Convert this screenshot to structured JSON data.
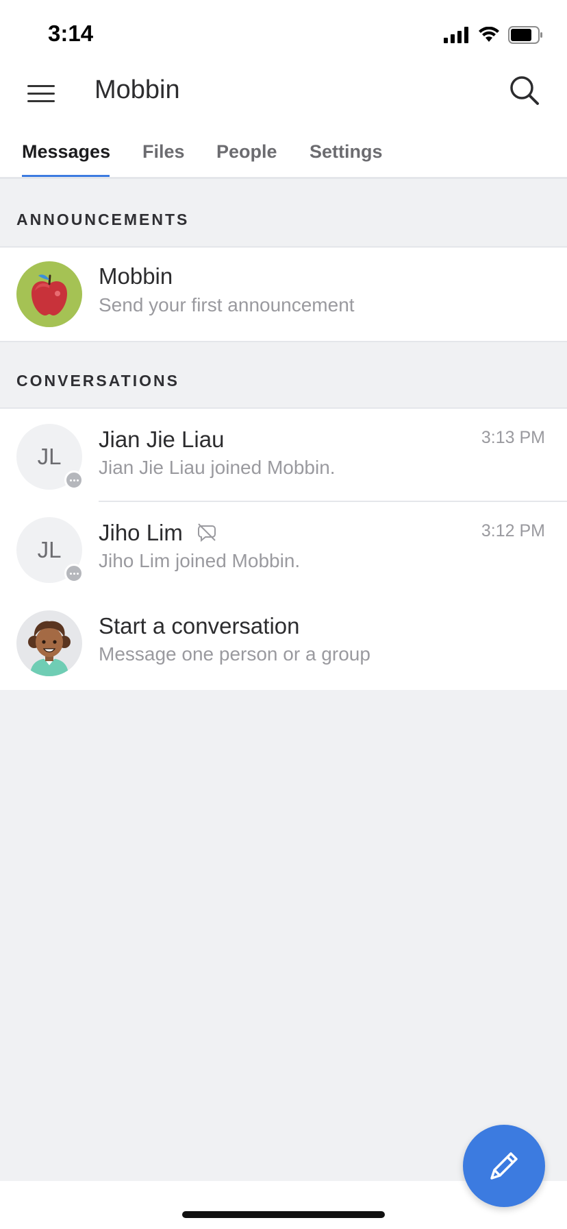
{
  "status_bar": {
    "time": "3:14"
  },
  "header": {
    "title": "Mobbin",
    "menu_icon": "hamburger-menu-icon",
    "search_icon": "search-icon"
  },
  "tabs": [
    {
      "label": "Messages",
      "active": true
    },
    {
      "label": "Files",
      "active": false
    },
    {
      "label": "People",
      "active": false
    },
    {
      "label": "Settings",
      "active": false
    }
  ],
  "announcements": {
    "heading": "ANNOUNCEMENTS",
    "item": {
      "title": "Mobbin",
      "subtitle": "Send your first announcement",
      "avatar_icon": "apple-icon"
    }
  },
  "conversations": {
    "heading": "CONVERSATIONS",
    "items": [
      {
        "initials": "JL",
        "name": "Jian Jie Liau",
        "preview": "Jian Jie Liau joined Mobbin.",
        "time": "3:13 PM",
        "muted": false
      },
      {
        "initials": "JL",
        "name": "Jiho Lim",
        "preview": "Jiho Lim joined Mobbin.",
        "time": "3:12 PM",
        "muted": true
      }
    ],
    "start": {
      "title": "Start a conversation",
      "subtitle": "Message one person or a group",
      "avatar_icon": "person-avatar-icon"
    }
  },
  "fab": {
    "icon": "pencil-icon"
  },
  "colors": {
    "accent": "#3c7be0",
    "background": "#f0f1f3",
    "apple_bg": "#a5c254"
  }
}
